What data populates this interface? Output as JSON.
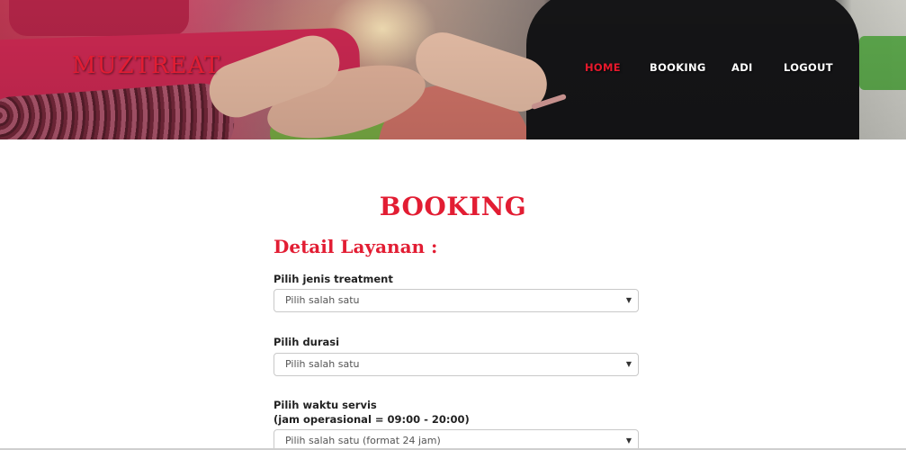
{
  "header": {
    "brand": "MUZTREAT",
    "nav": [
      {
        "label": "HOME",
        "active": true
      },
      {
        "label": "BOOKING",
        "active": false
      },
      {
        "label": "ADI",
        "active": false
      },
      {
        "label": "LOGOUT",
        "active": false
      }
    ],
    "accent_color": "#e21d33"
  },
  "main": {
    "title": "BOOKING",
    "section_title": "Detail Layanan :",
    "fields": [
      {
        "label": "Pilih jenis treatment",
        "label2": "",
        "placeholder": "Pilih salah satu"
      },
      {
        "label": "Pilih durasi",
        "label2": "",
        "placeholder": "Pilih salah satu"
      },
      {
        "label": "Pilih waktu servis",
        "label2": "(jam operasional = 09:00 - 20:00)",
        "placeholder": "Pilih salah satu (format 24 jam)"
      }
    ],
    "dropdown_icon": "caret-down-icon"
  }
}
